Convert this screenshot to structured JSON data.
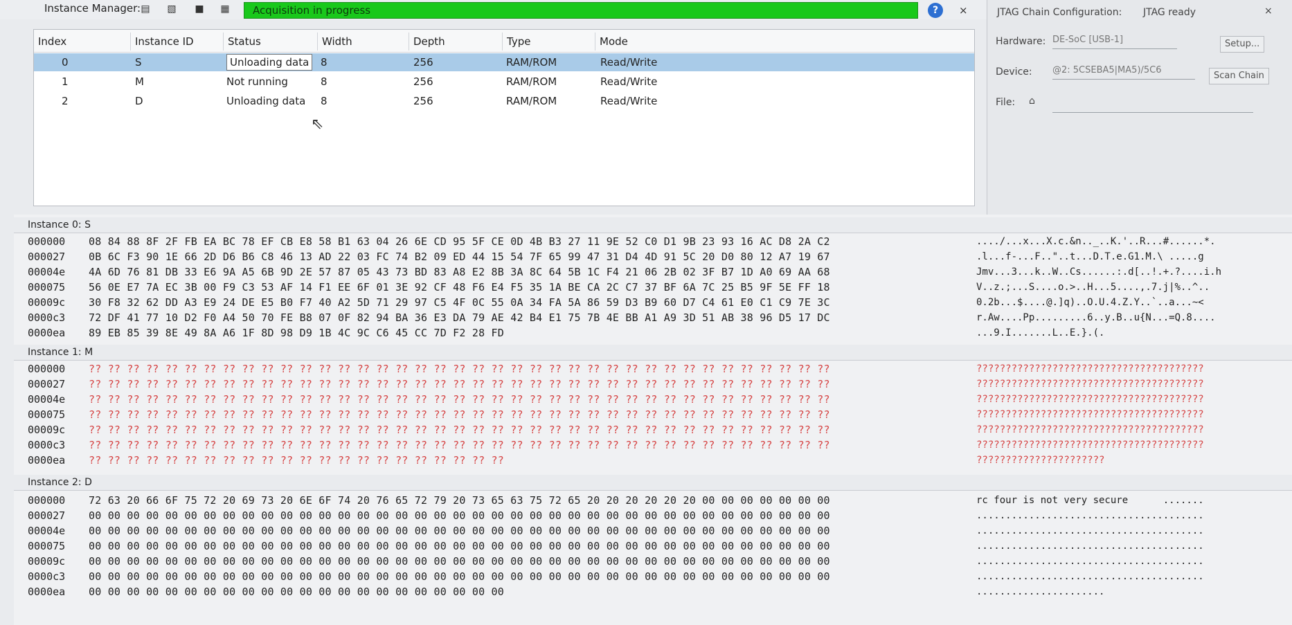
{
  "toolbar": {
    "title": "Instance Manager:",
    "status_text": "Acquisition in progress",
    "icons": [
      "run-analysis-icon",
      "autorun-icon",
      "stop-icon",
      "read-data-icon",
      "help-icon",
      "close-icon"
    ],
    "close_label": "×"
  },
  "instances_table": {
    "columns": [
      "Index",
      "Instance ID",
      "Status",
      "Width",
      "Depth",
      "Type",
      "Mode"
    ],
    "rows": [
      {
        "index": "0",
        "id": "S",
        "status": "Unloading data",
        "width": "8",
        "depth": "256",
        "type": "RAM/ROM",
        "mode": "Read/Write"
      },
      {
        "index": "1",
        "id": "M",
        "status": "Not running",
        "width": "8",
        "depth": "256",
        "type": "RAM/ROM",
        "mode": "Read/Write"
      },
      {
        "index": "2",
        "id": "D",
        "status": "Unloading data",
        "width": "8",
        "depth": "256",
        "type": "RAM/ROM",
        "mode": "Read/Write"
      }
    ]
  },
  "jtag": {
    "title": "JTAG Chain Configuration:",
    "status": "JTAG ready",
    "hardware_label": "Hardware:",
    "hardware_value": "DE-SoC [USB-1]",
    "setup_button": "Setup...",
    "device_label": "Device:",
    "device_value": "@2: 5CSEBA5|MA5)/5C6",
    "scan_button": "Scan Chain",
    "file_label": "File:",
    "close_label": "×"
  },
  "hex": {
    "sections": [
      {
        "title": "Instance 0: S",
        "red": false,
        "lines": [
          {
            "addr": "000000",
            "bytes": "08 84 88 8F 2F FB EA BC 78 EF CB E8 58 B1 63 04 26 6E CD 95 5F CE 0D 4B B3 27 11 9E 52 C0 D1 9B 23 93 16 AC D8 2A C2",
            "ascii": "..../...x...X.c.&n.._..K.'..R...#......*."
          },
          {
            "addr": "000027",
            "bytes": "0B 6C F3 90 1E 66 2D D6 B6 C8 46 13 AD 22 03 FC 74 B2 09 ED 44 15 54 7F 65 99 47 31 D4 4D 91 5C 20 D0 80 12 A7 19 67",
            "ascii": ".l...f-...F..\"..t...D.T.e.G1.M.\\ .....g"
          },
          {
            "addr": "00004e",
            "bytes": "4A 6D 76 81 DB 33 E6 9A A5 6B 9D 2E 57 87 05 43 73 BD 83 A8 E2 8B 3A 8C 64 5B 1C F4 21 06 2B 02 3F B7 1D A0 69 AA 68",
            "ascii": "Jmv...3...k..W..Cs......:.d[..!.+.?....i.h"
          },
          {
            "addr": "000075",
            "bytes": "56 0E E7 7A EC 3B 00 F9 C3 53 AF 14 F1 EE 6F 01 3E 92 CF 48 F6 E4 F5 35 1A BE CA 2C C7 37 BF 6A 7C 25 B5 9F 5E FF 18",
            "ascii": "V..z.;...S....o.>..H...5....,.7.j|%..^.."
          },
          {
            "addr": "00009c",
            "bytes": "30 F8 32 62 DD A3 E9 24 DE E5 B0 F7 40 A2 5D 71 29 97 C5 4F 0C 55 0A 34 FA 5A 86 59 D3 B9 60 D7 C4 61 E0 C1 C9 7E 3C",
            "ascii": "0.2b...$....@.]q)..O.U.4.Z.Y..`..a...~<"
          },
          {
            "addr": "0000c3",
            "bytes": "72 DF 41 77 10 D2 F0 A4 50 70 FE B8 07 0F 82 94 BA 36 E3 DA 79 AE 42 B4 E1 75 7B 4E BB A1 A9 3D 51 AB 38 96 D5 17 DC",
            "ascii": "r.Aw....Pp.........6..y.B..u{N...=Q.8...."
          },
          {
            "addr": "0000ea",
            "bytes": "89 EB 85 39 8E 49 8A A6 1F 8D 98 D9 1B 4C 9C C6 45 CC 7D F2 28 FD",
            "ascii": "...9.I.......L..E.}.(."
          }
        ]
      },
      {
        "title": "Instance 1: M",
        "red": true,
        "lines": [
          {
            "addr": "000000",
            "bytes": "?? ?? ?? ?? ?? ?? ?? ?? ?? ?? ?? ?? ?? ?? ?? ?? ?? ?? ?? ?? ?? ?? ?? ?? ?? ?? ?? ?? ?? ?? ?? ?? ?? ?? ?? ?? ?? ?? ??",
            "ascii": "???????????????????????????????????????"
          },
          {
            "addr": "000027",
            "bytes": "?? ?? ?? ?? ?? ?? ?? ?? ?? ?? ?? ?? ?? ?? ?? ?? ?? ?? ?? ?? ?? ?? ?? ?? ?? ?? ?? ?? ?? ?? ?? ?? ?? ?? ?? ?? ?? ?? ??",
            "ascii": "???????????????????????????????????????"
          },
          {
            "addr": "00004e",
            "bytes": "?? ?? ?? ?? ?? ?? ?? ?? ?? ?? ?? ?? ?? ?? ?? ?? ?? ?? ?? ?? ?? ?? ?? ?? ?? ?? ?? ?? ?? ?? ?? ?? ?? ?? ?? ?? ?? ?? ??",
            "ascii": "???????????????????????????????????????"
          },
          {
            "addr": "000075",
            "bytes": "?? ?? ?? ?? ?? ?? ?? ?? ?? ?? ?? ?? ?? ?? ?? ?? ?? ?? ?? ?? ?? ?? ?? ?? ?? ?? ?? ?? ?? ?? ?? ?? ?? ?? ?? ?? ?? ?? ??",
            "ascii": "???????????????????????????????????????"
          },
          {
            "addr": "00009c",
            "bytes": "?? ?? ?? ?? ?? ?? ?? ?? ?? ?? ?? ?? ?? ?? ?? ?? ?? ?? ?? ?? ?? ?? ?? ?? ?? ?? ?? ?? ?? ?? ?? ?? ?? ?? ?? ?? ?? ?? ??",
            "ascii": "???????????????????????????????????????"
          },
          {
            "addr": "0000c3",
            "bytes": "?? ?? ?? ?? ?? ?? ?? ?? ?? ?? ?? ?? ?? ?? ?? ?? ?? ?? ?? ?? ?? ?? ?? ?? ?? ?? ?? ?? ?? ?? ?? ?? ?? ?? ?? ?? ?? ?? ??",
            "ascii": "???????????????????????????????????????"
          },
          {
            "addr": "0000ea",
            "bytes": "?? ?? ?? ?? ?? ?? ?? ?? ?? ?? ?? ?? ?? ?? ?? ?? ?? ?? ?? ?? ?? ??",
            "ascii": "??????????????????????"
          }
        ]
      },
      {
        "title": "Instance 2: D",
        "red": false,
        "lines": [
          {
            "addr": "000000",
            "bytes": "72 63 20 66 6F 75 72 20 69 73 20 6E 6F 74 20 76 65 72 79 20 73 65 63 75 72 65 20 20 20 20 20 20 00 00 00 00 00 00 00",
            "ascii": "rc four is not very secure      ......."
          },
          {
            "addr": "000027",
            "bytes": "00 00 00 00 00 00 00 00 00 00 00 00 00 00 00 00 00 00 00 00 00 00 00 00 00 00 00 00 00 00 00 00 00 00 00 00 00 00 00",
            "ascii": "......................................."
          },
          {
            "addr": "00004e",
            "bytes": "00 00 00 00 00 00 00 00 00 00 00 00 00 00 00 00 00 00 00 00 00 00 00 00 00 00 00 00 00 00 00 00 00 00 00 00 00 00 00",
            "ascii": "......................................."
          },
          {
            "addr": "000075",
            "bytes": "00 00 00 00 00 00 00 00 00 00 00 00 00 00 00 00 00 00 00 00 00 00 00 00 00 00 00 00 00 00 00 00 00 00 00 00 00 00 00",
            "ascii": "......................................."
          },
          {
            "addr": "00009c",
            "bytes": "00 00 00 00 00 00 00 00 00 00 00 00 00 00 00 00 00 00 00 00 00 00 00 00 00 00 00 00 00 00 00 00 00 00 00 00 00 00 00",
            "ascii": "......................................."
          },
          {
            "addr": "0000c3",
            "bytes": "00 00 00 00 00 00 00 00 00 00 00 00 00 00 00 00 00 00 00 00 00 00 00 00 00 00 00 00 00 00 00 00 00 00 00 00 00 00 00",
            "ascii": "......................................."
          },
          {
            "addr": "0000ea",
            "bytes": "00 00 00 00 00 00 00 00 00 00 00 00 00 00 00 00 00 00 00 00 00 00",
            "ascii": "......................"
          }
        ]
      }
    ]
  }
}
